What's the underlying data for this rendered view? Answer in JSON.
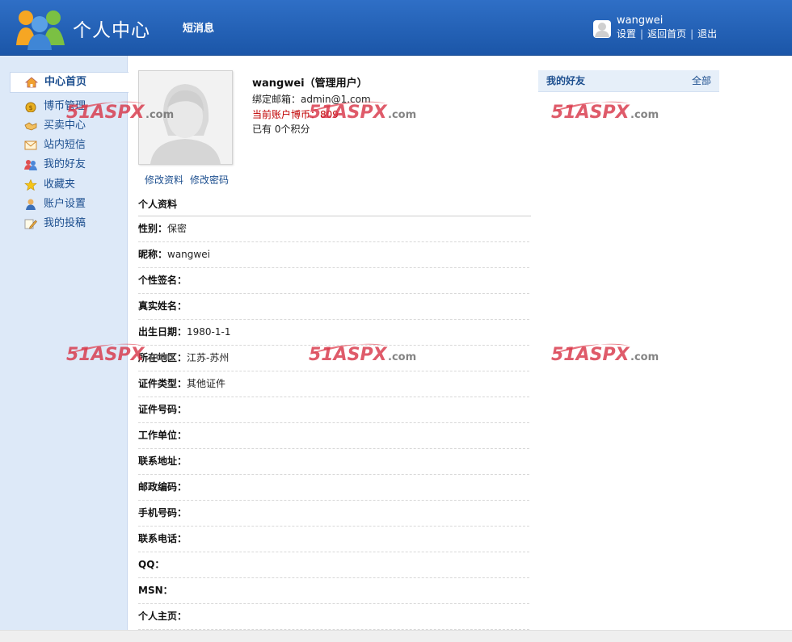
{
  "header": {
    "title": "个人中心",
    "messages_label": "短消息",
    "username": "wangwei",
    "links": [
      "设置",
      "返回首页",
      "退出"
    ],
    "colors": {
      "bar": "#1b56a8"
    }
  },
  "sidebar": {
    "items": [
      {
        "label": "中心首页",
        "icon": "home-icon",
        "active": true
      },
      {
        "label": "博币管理",
        "icon": "coin-bag-icon"
      },
      {
        "label": "买卖中心",
        "icon": "handshake-icon"
      },
      {
        "label": "站内短信",
        "icon": "envelope-icon"
      },
      {
        "label": "我的好友",
        "icon": "friends-icon"
      },
      {
        "label": "收藏夹",
        "icon": "star-icon"
      },
      {
        "label": "账户设置",
        "icon": "user-settings-icon"
      },
      {
        "label": "我的投稿",
        "icon": "pencil-note-icon"
      }
    ]
  },
  "profile": {
    "name": "wangwei（管理用户）",
    "email": "绑定邮箱：admin@1.com",
    "coins": "当前账户博币：809",
    "points": "已有 0个积分",
    "edit_profile": "修改资料",
    "edit_password": "修改密码"
  },
  "details": {
    "title": "个人资料",
    "rows": [
      {
        "k": "性别：",
        "v": "保密"
      },
      {
        "k": "昵称：",
        "v": "wangwei"
      },
      {
        "k": "个性签名：",
        "v": ""
      },
      {
        "k": "真实姓名：",
        "v": ""
      },
      {
        "k": "出生日期：",
        "v": "1980-1-1"
      },
      {
        "k": "所在地区：",
        "v": "江苏-苏州"
      },
      {
        "k": "证件类型：",
        "v": "其他证件"
      },
      {
        "k": "证件号码：",
        "v": ""
      },
      {
        "k": "工作单位：",
        "v": ""
      },
      {
        "k": "联系地址：",
        "v": ""
      },
      {
        "k": "邮政编码：",
        "v": ""
      },
      {
        "k": "手机号码：",
        "v": ""
      },
      {
        "k": "联系电话：",
        "v": ""
      },
      {
        "k": "QQ：",
        "v": ""
      },
      {
        "k": "MSN：",
        "v": ""
      },
      {
        "k": "个人主页：",
        "v": ""
      }
    ]
  },
  "friends": {
    "title": "我的好友",
    "all_label": "全部"
  },
  "watermark": "51ASPX.com"
}
